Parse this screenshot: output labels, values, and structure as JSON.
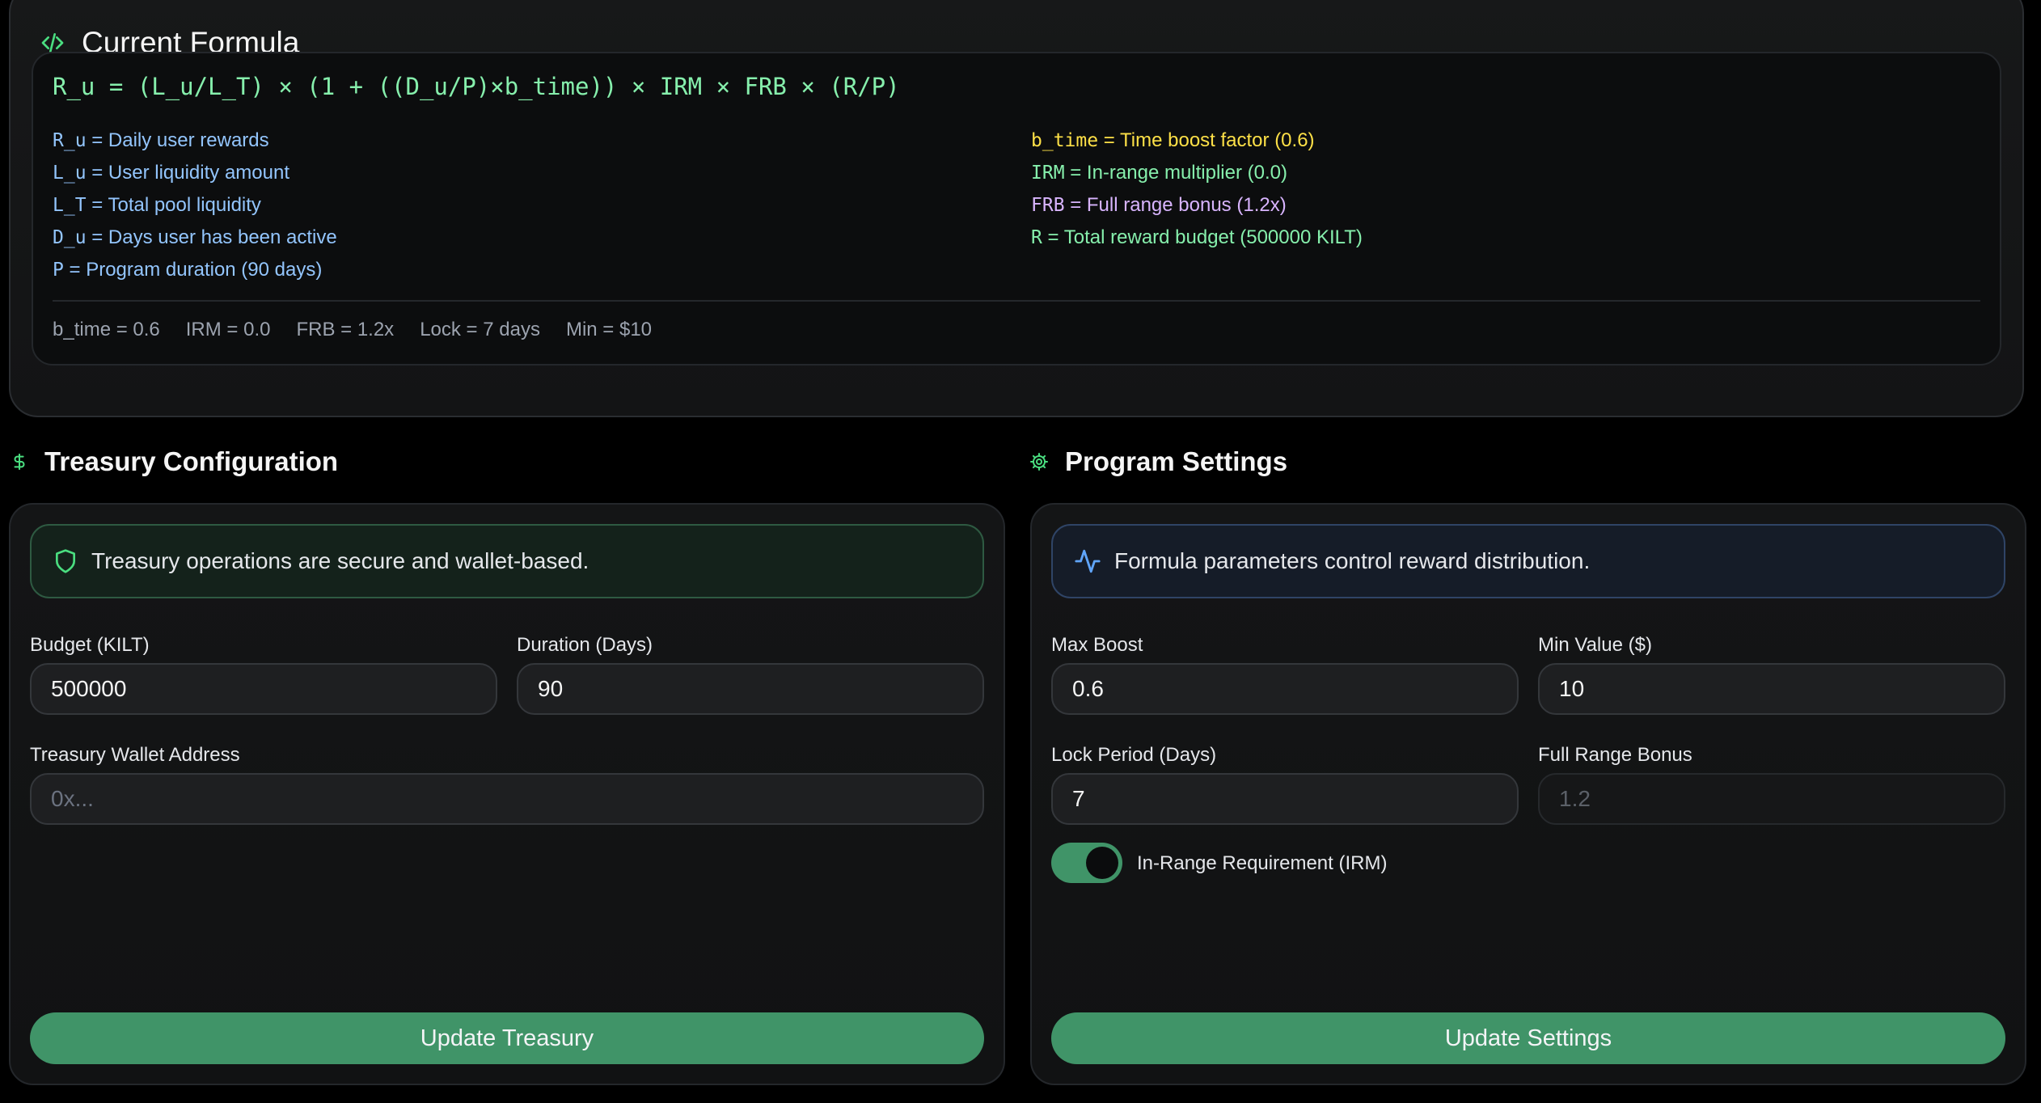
{
  "formula_card": {
    "title": "Current Formula",
    "icon": "code-icon",
    "formula": "R_u = (L_u/L_T) × (1 + ((D_u/P)×b_time)) × IRM × FRB × (R/P)",
    "legend_left": [
      {
        "key": "R_u",
        "text": " = Daily user rewards"
      },
      {
        "key": "L_u",
        "text": " = User liquidity amount"
      },
      {
        "key": "L_T",
        "text": " = Total pool liquidity"
      },
      {
        "key": "D_u",
        "text": " = Days user has been active"
      },
      {
        "key": "P",
        "text": " = Program duration (90 days)"
      }
    ],
    "legend_right": [
      {
        "key": "b_time",
        "text": " = Time boost factor (0.6)",
        "color": "#fde047"
      },
      {
        "key": "IRM",
        "text": " = In-range multiplier (0.0)",
        "color": "#86efac"
      },
      {
        "key": "FRB",
        "text": " = Full range bonus (1.2x)",
        "color": "#d8b4fe"
      },
      {
        "key": "R",
        "text": " = Total reward budget (500000 KILT)",
        "color": "#86efac"
      }
    ],
    "summary": [
      "b_time = 0.6",
      "IRM = 0.0",
      "FRB = 1.2x",
      "Lock = 7 days",
      "Min = $10"
    ]
  },
  "treasury": {
    "section_title": "Treasury Configuration",
    "icon": "dollar-icon",
    "notice_icon": "shield-icon",
    "notice": "Treasury operations are secure and wallet-based.",
    "budget_label": "Budget (KILT)",
    "budget_value": "500000",
    "duration_label": "Duration (Days)",
    "duration_value": "90",
    "wallet_label": "Treasury Wallet Address",
    "wallet_placeholder": "0x...",
    "button": "Update Treasury"
  },
  "program": {
    "section_title": "Program Settings",
    "icon": "gear-icon",
    "notice_icon": "activity-icon",
    "notice": "Formula parameters control reward distribution.",
    "max_boost_label": "Max Boost",
    "max_boost_value": "0.6",
    "min_value_label": "Min Value ($)",
    "min_value_value": "10",
    "lock_label": "Lock Period (Days)",
    "lock_value": "7",
    "frb_label": "Full Range Bonus",
    "frb_placeholder": "1.2",
    "toggle_label": "In-Range Requirement (IRM)",
    "toggle_on": true,
    "button": "Update Settings"
  },
  "colors": {
    "accent_green": "#409468",
    "formula_green": "#86efac",
    "legend_blue": "#93c5fd",
    "legend_yellow": "#fde047",
    "legend_purple": "#d8b4fe"
  }
}
